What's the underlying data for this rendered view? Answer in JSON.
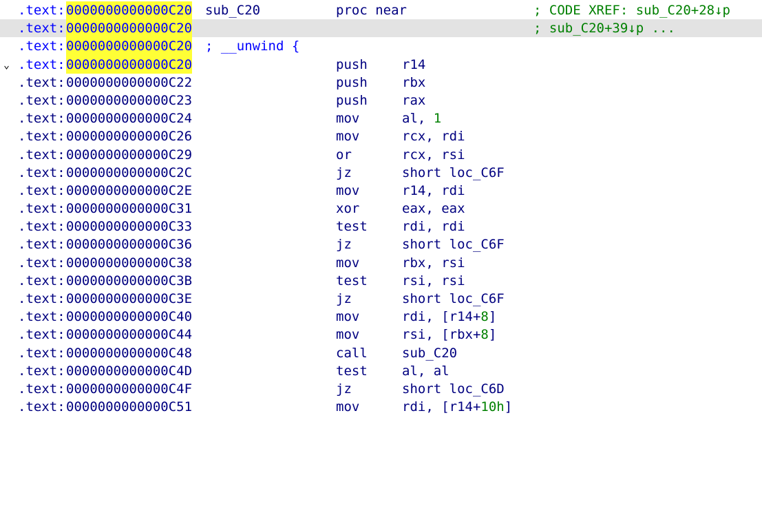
{
  "lines": [
    {
      "seg": ".text:",
      "addr": "0000000000000C20",
      "hl": true,
      "label": "sub_C20",
      "mnem": "proc near",
      "xref": "; CODE XREF: sub_C20+28↓p"
    },
    {
      "seg": ".text:",
      "addr": "0000000000000C20",
      "hl": true,
      "selected": true,
      "xref": "; sub_C20+39↓p ..."
    },
    {
      "seg": ".text:",
      "addr": "0000000000000C20",
      "hl": true,
      "inline": "; __unwind {"
    },
    {
      "seg": ".text:",
      "addr": "0000000000000C20",
      "hl": true,
      "fold": "⌄",
      "mnem": "push",
      "ops": "r14"
    },
    {
      "seg": ".text:",
      "addr": "0000000000000C22",
      "mnem": "push",
      "ops": "rbx"
    },
    {
      "seg": ".text:",
      "addr": "0000000000000C23",
      "mnem": "push",
      "ops": "rax"
    },
    {
      "seg": ".text:",
      "addr": "0000000000000C24",
      "mnem": "mov",
      "ops_pre": "al, ",
      "ops_num": "1"
    },
    {
      "seg": ".text:",
      "addr": "0000000000000C26",
      "mnem": "mov",
      "ops": "rcx, rdi"
    },
    {
      "seg": ".text:",
      "addr": "0000000000000C29",
      "mnem": "or",
      "ops": "rcx, rsi"
    },
    {
      "seg": ".text:",
      "addr": "0000000000000C2C",
      "mnem": "jz",
      "ops": "short loc_C6F"
    },
    {
      "seg": ".text:",
      "addr": "0000000000000C2E",
      "mnem": "mov",
      "ops": "r14, rdi"
    },
    {
      "seg": ".text:",
      "addr": "0000000000000C31",
      "mnem": "xor",
      "ops": "eax, eax"
    },
    {
      "seg": ".text:",
      "addr": "0000000000000C33",
      "mnem": "test",
      "ops": "rdi, rdi"
    },
    {
      "seg": ".text:",
      "addr": "0000000000000C36",
      "mnem": "jz",
      "ops": "short loc_C6F"
    },
    {
      "seg": ".text:",
      "addr": "0000000000000C38",
      "mnem": "mov",
      "ops": "rbx, rsi"
    },
    {
      "seg": ".text:",
      "addr": "0000000000000C3B",
      "mnem": "test",
      "ops": "rsi, rsi"
    },
    {
      "seg": ".text:",
      "addr": "0000000000000C3E",
      "mnem": "jz",
      "ops": "short loc_C6F"
    },
    {
      "seg": ".text:",
      "addr": "0000000000000C40",
      "mnem": "mov",
      "ops_pre": "rdi, [r14+",
      "ops_num": "8",
      "ops_post": "]"
    },
    {
      "seg": ".text:",
      "addr": "0000000000000C44",
      "mnem": "mov",
      "ops_pre": "rsi, [rbx+",
      "ops_num": "8",
      "ops_post": "]"
    },
    {
      "seg": ".text:",
      "addr": "0000000000000C48",
      "mnem": "call",
      "ops": "sub_C20"
    },
    {
      "seg": ".text:",
      "addr": "0000000000000C4D",
      "mnem": "test",
      "ops": "al, al"
    },
    {
      "seg": ".text:",
      "addr": "0000000000000C4F",
      "mnem": "jz",
      "ops": "short loc_C6D"
    },
    {
      "seg": ".text:",
      "addr": "0000000000000C51",
      "mnem": "mov",
      "ops_pre": "rdi, [r14+",
      "ops_num": "10h",
      "ops_post": "]"
    }
  ]
}
